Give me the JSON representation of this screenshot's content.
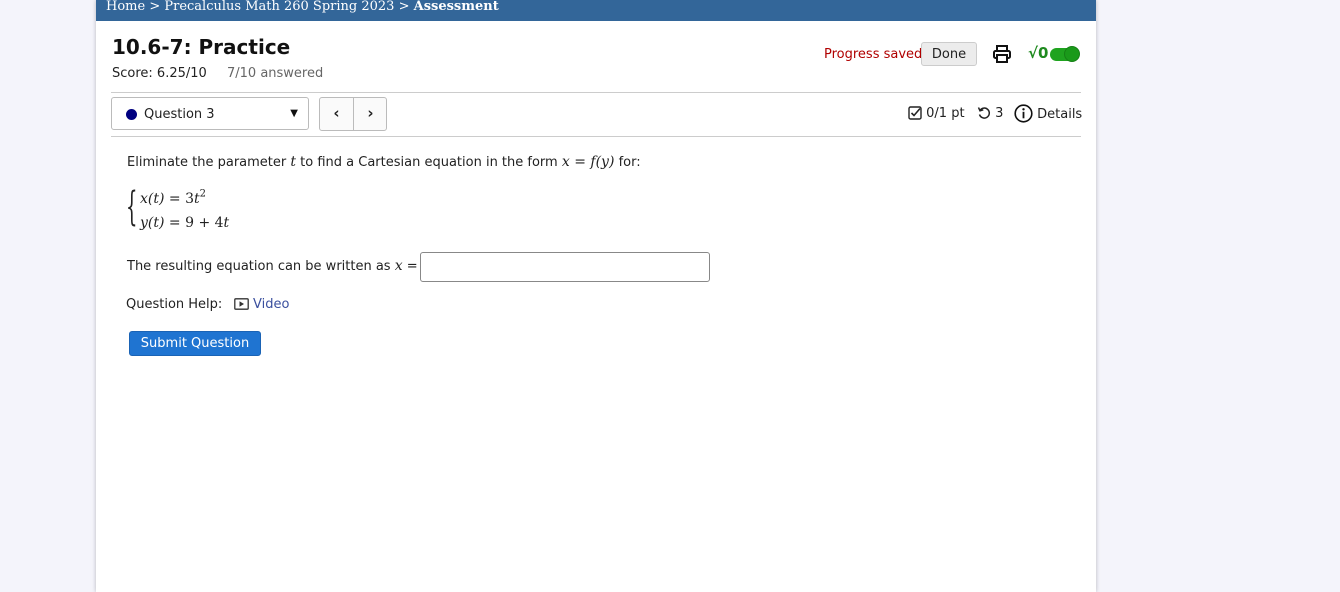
{
  "breadcrumb": {
    "home": "Home",
    "sep1": " > ",
    "course": "Precalculus Math 260 Spring 2023",
    "sep2": " > ",
    "current": "Assessment"
  },
  "header": {
    "title": "10.6-7: Practice",
    "score": "Score: 6.25/10",
    "answered": "7/10 answered",
    "progress_status": "Progress saved",
    "done_label": "Done",
    "math_toggle_label": "√0"
  },
  "question_nav": {
    "selected_question": "Question 3",
    "prev_symbol": "‹",
    "next_symbol": "›",
    "points": "0/1 pt",
    "tries": "3",
    "details_label": "Details"
  },
  "question": {
    "prompt_before": "Eliminate the parameter ",
    "param": "t",
    "prompt_middle": " to find a Cartesian equation in the form ",
    "form_x": "x",
    "form_eq": " = ",
    "form_f": "f",
    "form_arg": "(y)",
    "prompt_after": " for:",
    "eq1_lhs": "x(t)",
    "eq1_rel": " = 3",
    "eq1_var": "t",
    "eq1_exp": "2",
    "eq2_lhs": "y(t)",
    "eq2_rel": " = 9 + 4",
    "eq2_var": "t",
    "result_label": "The resulting equation can be written as ",
    "result_var": "x",
    "result_eq": " =",
    "answer_value": ""
  },
  "help": {
    "label": "Question Help:",
    "video_label": "Video"
  },
  "actions": {
    "submit_label": "Submit Question"
  },
  "colors": {
    "header_bar": "#336699",
    "progress_saved": "#b00000",
    "submit": "#1f74d1",
    "link": "#3a4f9e",
    "question_dot": "#000080",
    "toggle": "#1fa31f"
  }
}
